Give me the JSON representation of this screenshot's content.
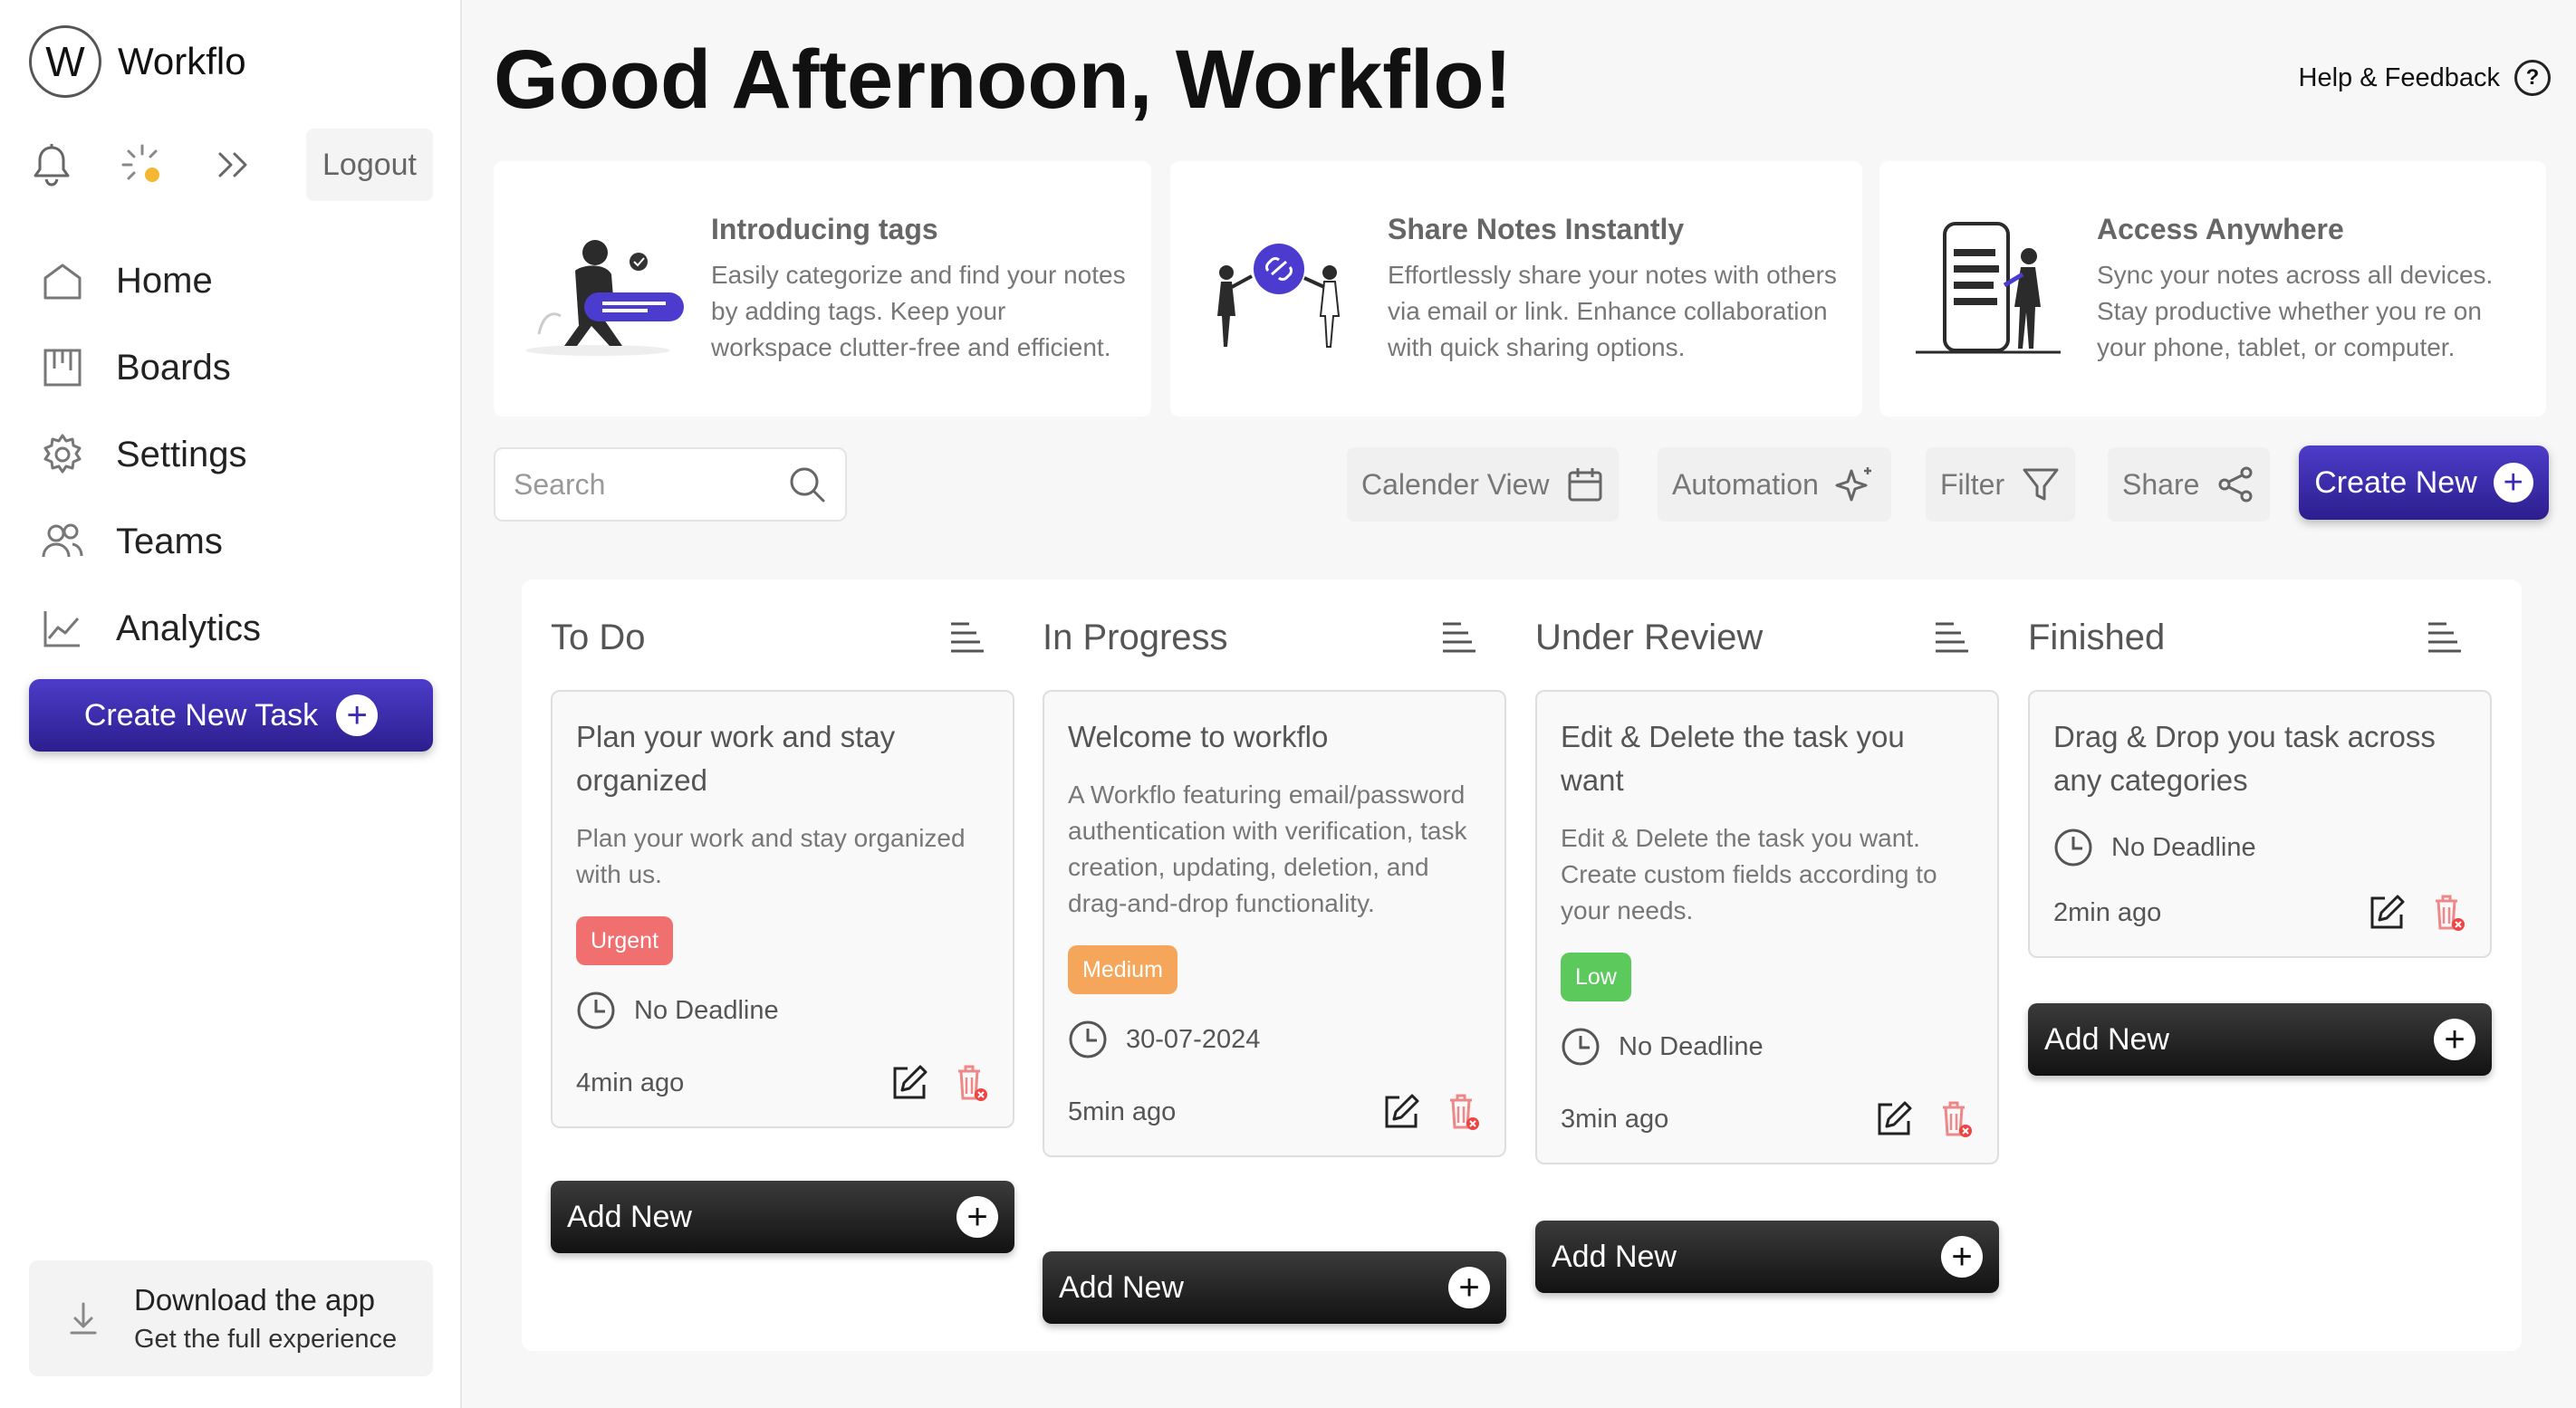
{
  "brand": {
    "initial": "W",
    "name": "Workflo"
  },
  "sidebar": {
    "logout_label": "Logout",
    "nav": [
      {
        "label": "Home",
        "icon": "home-icon"
      },
      {
        "label": "Boards",
        "icon": "boards-icon"
      },
      {
        "label": "Settings",
        "icon": "settings-icon"
      },
      {
        "label": "Teams",
        "icon": "teams-icon"
      },
      {
        "label": "Analytics",
        "icon": "analytics-icon"
      }
    ],
    "create_task_label": "Create New Task",
    "download": {
      "title": "Download the app",
      "subtitle": "Get the full experience"
    }
  },
  "header": {
    "greeting": "Good Afternoon, Workflo!",
    "help_label": "Help & Feedback"
  },
  "features": [
    {
      "title": "Introducing tags",
      "description": "Easily categorize and find your notes by adding tags. Keep your workspace clutter-free and efficient."
    },
    {
      "title": "Share Notes Instantly",
      "description": "Effortlessly share your notes with others via email or link. Enhance collaboration with quick sharing options."
    },
    {
      "title": "Access Anywhere",
      "description": "Sync your notes across all devices. Stay productive whether you re on your phone, tablet, or computer."
    }
  ],
  "toolbar": {
    "search_placeholder": "Search",
    "calendar_label": "Calender View",
    "automation_label": "Automation",
    "filter_label": "Filter",
    "share_label": "Share",
    "create_new_label": "Create New"
  },
  "columns": [
    {
      "title": "To Do",
      "add_label": "Add New",
      "card": {
        "title": "Plan your work and stay organized",
        "description": "Plan your work and stay organized with us.",
        "priority": "Urgent",
        "deadline": "No Deadline",
        "time": "4min ago"
      }
    },
    {
      "title": "In Progress",
      "add_label": "Add New",
      "card": {
        "title": "Welcome to workflo",
        "description": "A Workflo featuring email/password authentication with verification, task creation, updating, deletion, and drag-and-drop functionality.",
        "priority": "Medium",
        "deadline": "30-07-2024",
        "time": "5min ago"
      }
    },
    {
      "title": "Under Review",
      "add_label": "Add New",
      "card": {
        "title": "Edit & Delete the task you want",
        "description": "Edit & Delete the task you want. Create custom fields according to your needs.",
        "priority": "Low",
        "deadline": "No Deadline",
        "time": "3min ago"
      }
    },
    {
      "title": "Finished",
      "add_label": "Add New",
      "card": {
        "title": "Drag & Drop you task across any categories",
        "deadline": "No Deadline",
        "time": "2min ago"
      }
    }
  ],
  "colors": {
    "accent": "#3a2bb0",
    "urgent": "#f07070",
    "medium": "#f5a65b",
    "low": "#5cc95c"
  }
}
